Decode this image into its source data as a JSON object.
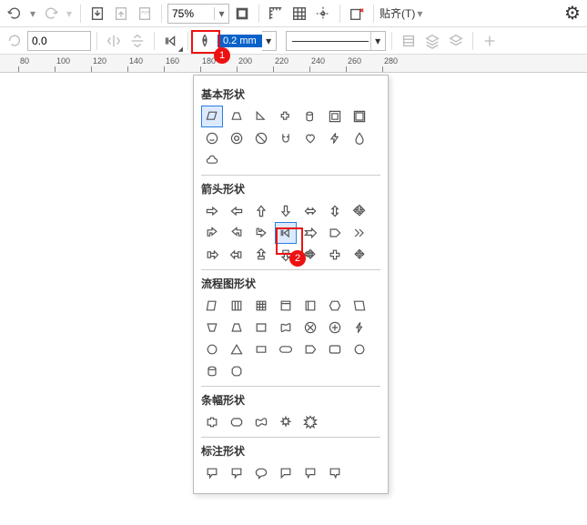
{
  "toolbar1": {
    "zoom": "75%",
    "snap_label": "贴齐(T)"
  },
  "toolbar2": {
    "rotation": "0.0",
    "stroke_width": "0.2 mm"
  },
  "ruler_ticks": [
    80,
    100,
    120,
    140,
    160,
    180,
    200,
    220,
    240,
    260,
    280
  ],
  "annotations": {
    "badge1": "1",
    "badge2": "2"
  },
  "panel": {
    "sections": [
      {
        "title": "基本形状",
        "rows": [
          [
            "parallelogram",
            "trapezoid",
            "triangle-right",
            "plus",
            "cylinder",
            "frame",
            "frame2"
          ],
          [
            "smiley",
            "donut",
            "no",
            "magnet",
            "heart",
            "bolt",
            "drop"
          ],
          [
            "cloud"
          ]
        ]
      },
      {
        "title": "箭头形状",
        "rows": [
          [
            "arrow-r",
            "arrow-l",
            "arrow-u",
            "arrow-d",
            "arrow-lr",
            "arrow-ud",
            "arrow-quad"
          ],
          [
            "corner-ul",
            "corner-ur",
            "corner-dr",
            "striped-arrow",
            "arrow-notch",
            "pentagon-r",
            "chev-r"
          ],
          [
            "tee-r",
            "tee-l",
            "tee-u",
            "tee-d",
            "cross-arrow",
            "plus-arrow",
            "quad-out"
          ]
        ]
      },
      {
        "title": "流程图形状",
        "rows": [
          [
            "fc-skew",
            "fc-cols",
            "fc-grid",
            "fc-card",
            "fc-card2",
            "fc-hex",
            "fc-skew2"
          ],
          [
            "fc-trap",
            "fc-trap2",
            "fc-rect",
            "fc-wave",
            "fc-xcircle",
            "fc-pluscircle",
            "fc-flash"
          ],
          [
            "fc-disc",
            "fc-tri",
            "fc-rect2",
            "fc-pill",
            "fc-tag",
            "fc-rrect",
            "fc-circle"
          ],
          [
            "fc-cyl",
            "fc-oct"
          ]
        ]
      },
      {
        "title": "条幅形状",
        "rows": [
          [
            "banner1",
            "banner2",
            "wave",
            "burst1",
            "burst2"
          ]
        ]
      },
      {
        "title": "标注形状",
        "rows": [
          [
            "callout1",
            "callout2",
            "callout-oval",
            "callout-z",
            "callout3",
            "callout4"
          ]
        ]
      }
    ]
  }
}
